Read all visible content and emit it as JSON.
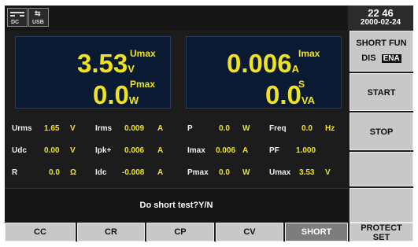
{
  "status": {
    "dc_icon_label": "DC",
    "usb_icon_label": "USB",
    "usb_icon_symbol": "⇆",
    "time": "22 46",
    "date": "2000-02-24"
  },
  "display_left": {
    "top_value": "3.53",
    "top_unit": "V",
    "top_label": "Umax",
    "bottom_value": "0.0",
    "bottom_unit": "W",
    "bottom_label": "Pmax"
  },
  "display_right": {
    "top_value": "0.006",
    "top_unit": "A",
    "top_label": "Imax",
    "bottom_value": "0.0",
    "bottom_unit": "VA",
    "bottom_label": "S"
  },
  "readings": [
    {
      "label": "Urms",
      "value": "1.65",
      "unit": "V"
    },
    {
      "label": "Irms",
      "value": "0.009",
      "unit": "A"
    },
    {
      "label": "P",
      "value": "0.0",
      "unit": "W"
    },
    {
      "label": "Freq",
      "value": "0.0",
      "unit": "Hz"
    },
    {
      "label": "Udc",
      "value": "0.00",
      "unit": "V"
    },
    {
      "label": "Ipk+",
      "value": "0.006",
      "unit": "A"
    },
    {
      "label": "Imax",
      "value": "0.006",
      "unit": "A"
    },
    {
      "label": "PF",
      "value": "1.000",
      "unit": ""
    },
    {
      "label": "R",
      "value": "0.0",
      "unit": "Ω"
    },
    {
      "label": "Idc",
      "value": "-0.008",
      "unit": "A"
    },
    {
      "label": "Pmax",
      "value": "0.0",
      "unit": "W"
    },
    {
      "label": "Umax",
      "value": "3.53",
      "unit": "V"
    }
  ],
  "prompt": "Do short test?Y/N",
  "softkeys": {
    "short_fun_title": "SHORT FUN",
    "short_fun_dis": "DIS",
    "short_fun_ena": "ENA",
    "short_fun_selected": "ENA",
    "start": "START",
    "stop": "STOP"
  },
  "modes": {
    "cc": "CC",
    "cr": "CR",
    "cp": "CP",
    "cv": "CV",
    "short": "SHORT",
    "protect_line1": "PROTECT",
    "protect_line2": "SET",
    "active": "SHORT"
  },
  "colors": {
    "screen_bg": "#1c1c1c",
    "value_yellow": "#f0e21d",
    "panel_blue": "#0b1a33",
    "key_gray": "#c8c8c8",
    "active_key": "#7d7d7d"
  }
}
